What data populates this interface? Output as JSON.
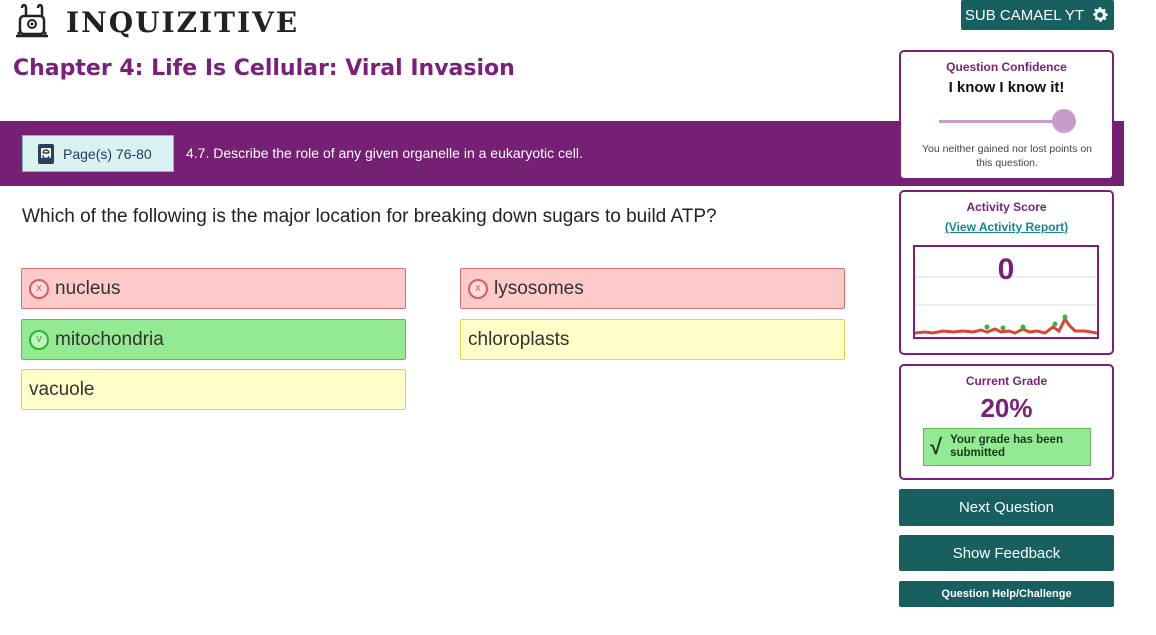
{
  "header": {
    "app_name": "INQUIZITIVE",
    "user_label": "SUB CAMAEL YT",
    "logo_icon": "dog-logo-icon",
    "settings_icon": "gear-icon"
  },
  "chapter_title": "Chapter 4: Life Is Cellular: Viral Invasion",
  "objective_bar": {
    "page_label": "Page(s) 76-80",
    "book_icon": "ebook-icon",
    "objective_text": "4.7. Describe the role of any given organelle in a eukaryotic cell."
  },
  "question": {
    "text": "Which of the following is the major location for breaking down sugars to build ATP?"
  },
  "answers": [
    {
      "label": "nucleus",
      "state": "wrong"
    },
    {
      "label": "lysosomes",
      "state": "wrong"
    },
    {
      "label": "mitochondria",
      "state": "correct"
    },
    {
      "label": "chloroplasts",
      "state": "unselected"
    },
    {
      "label": "vacuole",
      "state": "unselected"
    }
  ],
  "marks": {
    "wrong": "x",
    "correct": "v"
  },
  "confidence": {
    "title": "Question Confidence",
    "value": "I know I know it!",
    "note": "You neither gained nor lost points on this question.",
    "level": 1.0
  },
  "activity": {
    "title": "Activity Score",
    "link": "(View Activity Report)",
    "score": "0"
  },
  "grade": {
    "title": "Current Grade",
    "value": "20%",
    "submitted_check": "√",
    "submitted_text": "Your grade has been submitted"
  },
  "buttons": {
    "next": "Next Question",
    "feedback": "Show Feedback",
    "help": "Question Help/Challenge"
  },
  "colors": {
    "brand_purple": "#762074",
    "teal": "#17605f",
    "wrong_bg": "#fdcaca",
    "correct_bg": "#94e993",
    "neutral_bg": "#fffec8"
  }
}
